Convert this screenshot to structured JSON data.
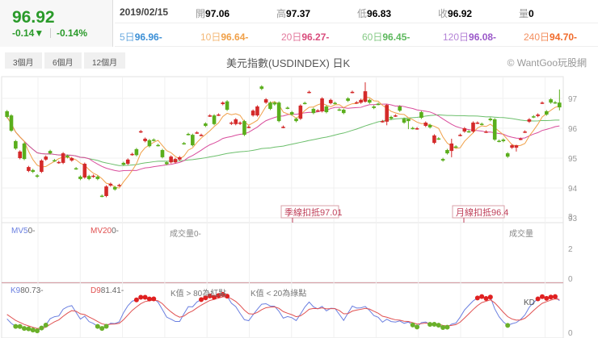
{
  "quote": {
    "price": "96.92",
    "change": "-0.14▼",
    "change_pct": "-0.14%"
  },
  "info": {
    "date": "2019/02/15",
    "open_label": "開",
    "open": "97.06",
    "high_label": "高",
    "high": "97.37",
    "low_label": "低",
    "low": "96.83",
    "close_label": "收",
    "close": "96.92",
    "vol_label": "量",
    "vol": "0"
  },
  "ma": [
    {
      "label": "5日",
      "value": "96.96-",
      "color": "#3b8fd6"
    },
    {
      "label": "10日",
      "value": "96.64-",
      "color": "#f0a048"
    },
    {
      "label": "20日",
      "value": "96.27-",
      "color": "#d94c7c"
    },
    {
      "label": "60日",
      "value": "96.45-",
      "color": "#5cb85c"
    },
    {
      "label": "120日",
      "value": "96.08-",
      "color": "#9b59c9"
    },
    {
      "label": "240日",
      "value": "94.70-",
      "color": "#f06a2a"
    }
  ],
  "toolbar": {
    "btn3": "3個月",
    "btn6": "6個月",
    "btn12": "12個月",
    "title": "美元指數(USDINDEX) 日K",
    "copyright": "© WantGoo玩股網"
  },
  "volume": {
    "mv5_label": "MV5",
    "mv5": "0-",
    "mv20_label": "MV20",
    "mv20": "0-",
    "vol_label": "成交量",
    "vol": "0-",
    "panel_label": "成交量",
    "axis": [
      "3",
      "2",
      "0"
    ]
  },
  "kd": {
    "k_label": "K9",
    "k": "80.73-",
    "d_label": "D9",
    "d": "81.41-",
    "note1": "K值 > 80為紅點",
    "note2": "K值 < 20為綠點",
    "panel_label": "KD",
    "axis": [
      "0"
    ]
  },
  "markers": {
    "season": "季線扣抵97.01",
    "month": "月線扣抵96.4"
  },
  "colors": {
    "up": "#d42a2a",
    "down": "#5aae1c",
    "ma5": "#f0a048",
    "ma20": "#d94c9c",
    "ma60": "#6cbf6c",
    "k": "#6a7fe0",
    "d": "#e05050"
  },
  "chart_data": {
    "type": "candlestick",
    "yaxis": [
      "97",
      "96",
      "95",
      "94",
      "93"
    ],
    "ylim": [
      92.9,
      97.6
    ],
    "candles": [
      [
        96.57,
        96.38
      ],
      [
        96.43,
        95.92
      ],
      [
        95.57,
        95.32
      ],
      [
        95.0,
        95.22
      ],
      [
        95.49,
        94.97
      ],
      [
        94.57,
        94.7
      ],
      [
        94.6,
        94.54
      ],
      [
        94.42,
        94.38
      ],
      [
        94.54,
        94.92
      ],
      [
        94.95,
        95.05
      ],
      [
        95.24,
        95.16
      ],
      [
        94.93,
        94.92
      ],
      [
        94.85,
        94.87
      ],
      [
        94.84,
        95.16
      ],
      [
        95.08,
        95.03
      ],
      [
        94.92,
        95.0
      ],
      [
        94.66,
        94.65
      ],
      [
        94.38,
        94.3
      ],
      [
        94.35,
        94.81
      ],
      [
        94.4,
        94.3
      ],
      [
        94.38,
        94.41
      ],
      [
        94.38,
        94.3
      ],
      [
        93.74,
        93.73
      ],
      [
        93.73,
        94.05
      ],
      [
        94.08,
        94.14
      ],
      [
        94.03,
        93.95
      ],
      [
        94.08,
        94.1
      ],
      [
        94.84,
        94.78
      ],
      [
        94.81,
        94.95
      ],
      [
        95.12,
        95.14
      ],
      [
        95.3,
        95.1
      ],
      [
        95.88,
        95.9
      ],
      [
        95.57,
        95.65
      ],
      [
        95.6,
        95.4
      ],
      [
        95.62,
        95.6
      ],
      [
        95.44,
        95.43
      ],
      [
        95.27,
        95.03
      ],
      [
        94.86,
        94.8
      ],
      [
        94.86,
        95.05
      ],
      [
        94.86,
        94.97
      ],
      [
        94.95,
        95.03
      ],
      [
        95.5,
        95.49
      ],
      [
        95.81,
        95.8
      ],
      [
        95.78,
        95.43
      ],
      [
        95.85,
        95.86
      ],
      [
        95.77,
        95.78
      ],
      [
        96.16,
        96.08
      ],
      [
        96.42,
        96.43
      ],
      [
        96.43,
        96.14
      ],
      [
        96.45,
        96.46
      ],
      [
        96.81,
        96.86
      ],
      [
        96.9,
        96.62
      ],
      [
        96.15,
        96.19
      ],
      [
        96.14,
        96.3
      ],
      [
        96.15,
        96.19
      ],
      [
        96.24,
        95.78
      ],
      [
        96.04,
        96.05
      ],
      [
        96.43,
        96.59
      ],
      [
        96.43,
        96.73
      ],
      [
        97.4,
        97.32
      ],
      [
        96.86,
        96.97
      ],
      [
        96.86,
        96.65
      ],
      [
        96.86,
        96.8
      ],
      [
        96.86,
        96.24
      ],
      [
        96.04,
        96.05
      ],
      [
        96.69,
        96.68
      ],
      [
        96.54,
        96.46
      ],
      [
        96.32,
        96.24
      ],
      [
        96.32,
        96.76
      ],
      [
        96.85,
        96.84
      ],
      [
        97.21,
        97.22
      ],
      [
        96.65,
        96.51
      ],
      [
        96.59,
        96.6
      ],
      [
        96.57,
        97.0
      ],
      [
        96.73,
        96.54
      ],
      [
        96.84,
        96.95
      ],
      [
        96.85,
        96.84
      ],
      [
        96.63,
        96.62
      ],
      [
        96.62,
        96.51
      ],
      [
        97.0,
        96.92
      ],
      [
        97.21,
        97.22
      ],
      [
        96.86,
        96.87
      ],
      [
        96.86,
        96.95
      ],
      [
        96.89,
        97.24,
        97.54,
        96.86
      ],
      [
        96.95,
        96.86
      ],
      [
        96.73,
        96.68
      ],
      [
        96.82,
        96.81
      ],
      [
        96.23,
        96.24
      ],
      [
        96.22,
        96.78,
        96.81,
        96.1
      ],
      [
        96.38,
        96.32
      ],
      [
        96.42,
        96.43
      ],
      [
        96.73,
        96.59
      ],
      [
        96.32,
        96.19
      ],
      [
        96.32,
        96.24,
        96.32,
        95.97
      ],
      [
        96.01,
        96.0
      ],
      [
        95.99,
        96.0
      ],
      [
        96.54,
        96.35
      ],
      [
        96.08,
        96.19
      ],
      [
        96.11,
        96.03
      ],
      [
        95.51,
        95.76
      ],
      [
        95.66,
        95.65
      ],
      [
        94.97,
        94.92
      ],
      [
        95.27,
        95.16
      ],
      [
        95.24,
        95.49,
        95.65,
        95.03
      ],
      [
        95.39,
        95.38
      ],
      [
        95.77,
        95.78
      ],
      [
        95.89,
        96.0
      ],
      [
        95.9,
        95.89
      ],
      [
        95.89,
        96.19
      ],
      [
        96.18,
        96.19
      ],
      [
        96.15,
        96.14
      ],
      [
        95.88,
        95.89
      ],
      [
        96.32,
        96.27
      ],
      [
        96.3,
        95.62
      ],
      [
        95.58,
        95.57
      ],
      [
        95.62,
        95.57
      ],
      [
        95.16,
        95.05
      ],
      [
        95.35,
        95.43
      ],
      [
        95.35,
        95.43,
        95.45,
        95.22
      ],
      [
        95.64,
        95.65
      ],
      [
        95.88,
        95.89
      ],
      [
        96.22,
        96.3
      ],
      [
        96.4,
        96.38
      ],
      [
        96.41,
        96.46
      ],
      [
        96.85,
        96.86
      ],
      [
        96.57,
        96.46
      ],
      [
        96.97,
        96.86
      ],
      [
        96.87,
        96.86
      ],
      [
        96.86,
        96.7,
        97.3,
        96.6
      ]
    ]
  }
}
